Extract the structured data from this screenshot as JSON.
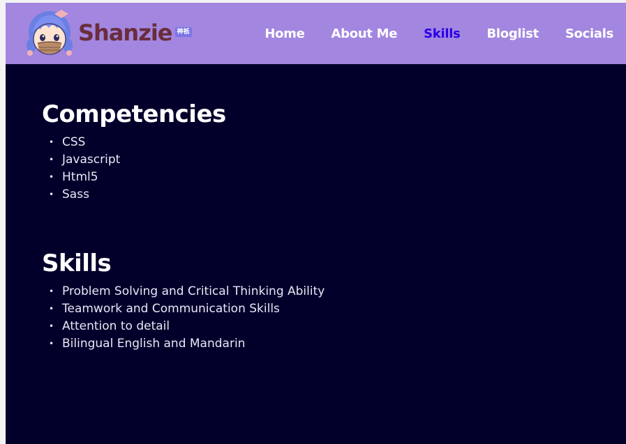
{
  "header": {
    "brand_name": "Shanzie",
    "brand_badge": "神祇",
    "nav": [
      {
        "label": "Home",
        "active": false
      },
      {
        "label": "About Me",
        "active": false
      },
      {
        "label": "Skills",
        "active": true
      },
      {
        "label": "Bloglist",
        "active": false
      },
      {
        "label": "Socials",
        "active": false
      }
    ]
  },
  "sections": [
    {
      "title": "Competencies",
      "items": [
        "CSS",
        "Javascript",
        "Html5",
        "Sass"
      ]
    },
    {
      "title": "Skills",
      "items": [
        "Problem Solving and Critical Thinking Ability",
        "Teamwork and Communication Skills",
        "Attention to detail",
        "Bilingual English and Mandarin"
      ]
    }
  ],
  "colors": {
    "header_bg": "#a286e0",
    "page_bg": "#02002b",
    "brand_text": "#6a2d3d",
    "nav_active": "#2b00e6",
    "nav_default": "#ffffff"
  },
  "icons": {
    "avatar": "avatar-icon",
    "bullet": "bullet-dot-icon"
  }
}
